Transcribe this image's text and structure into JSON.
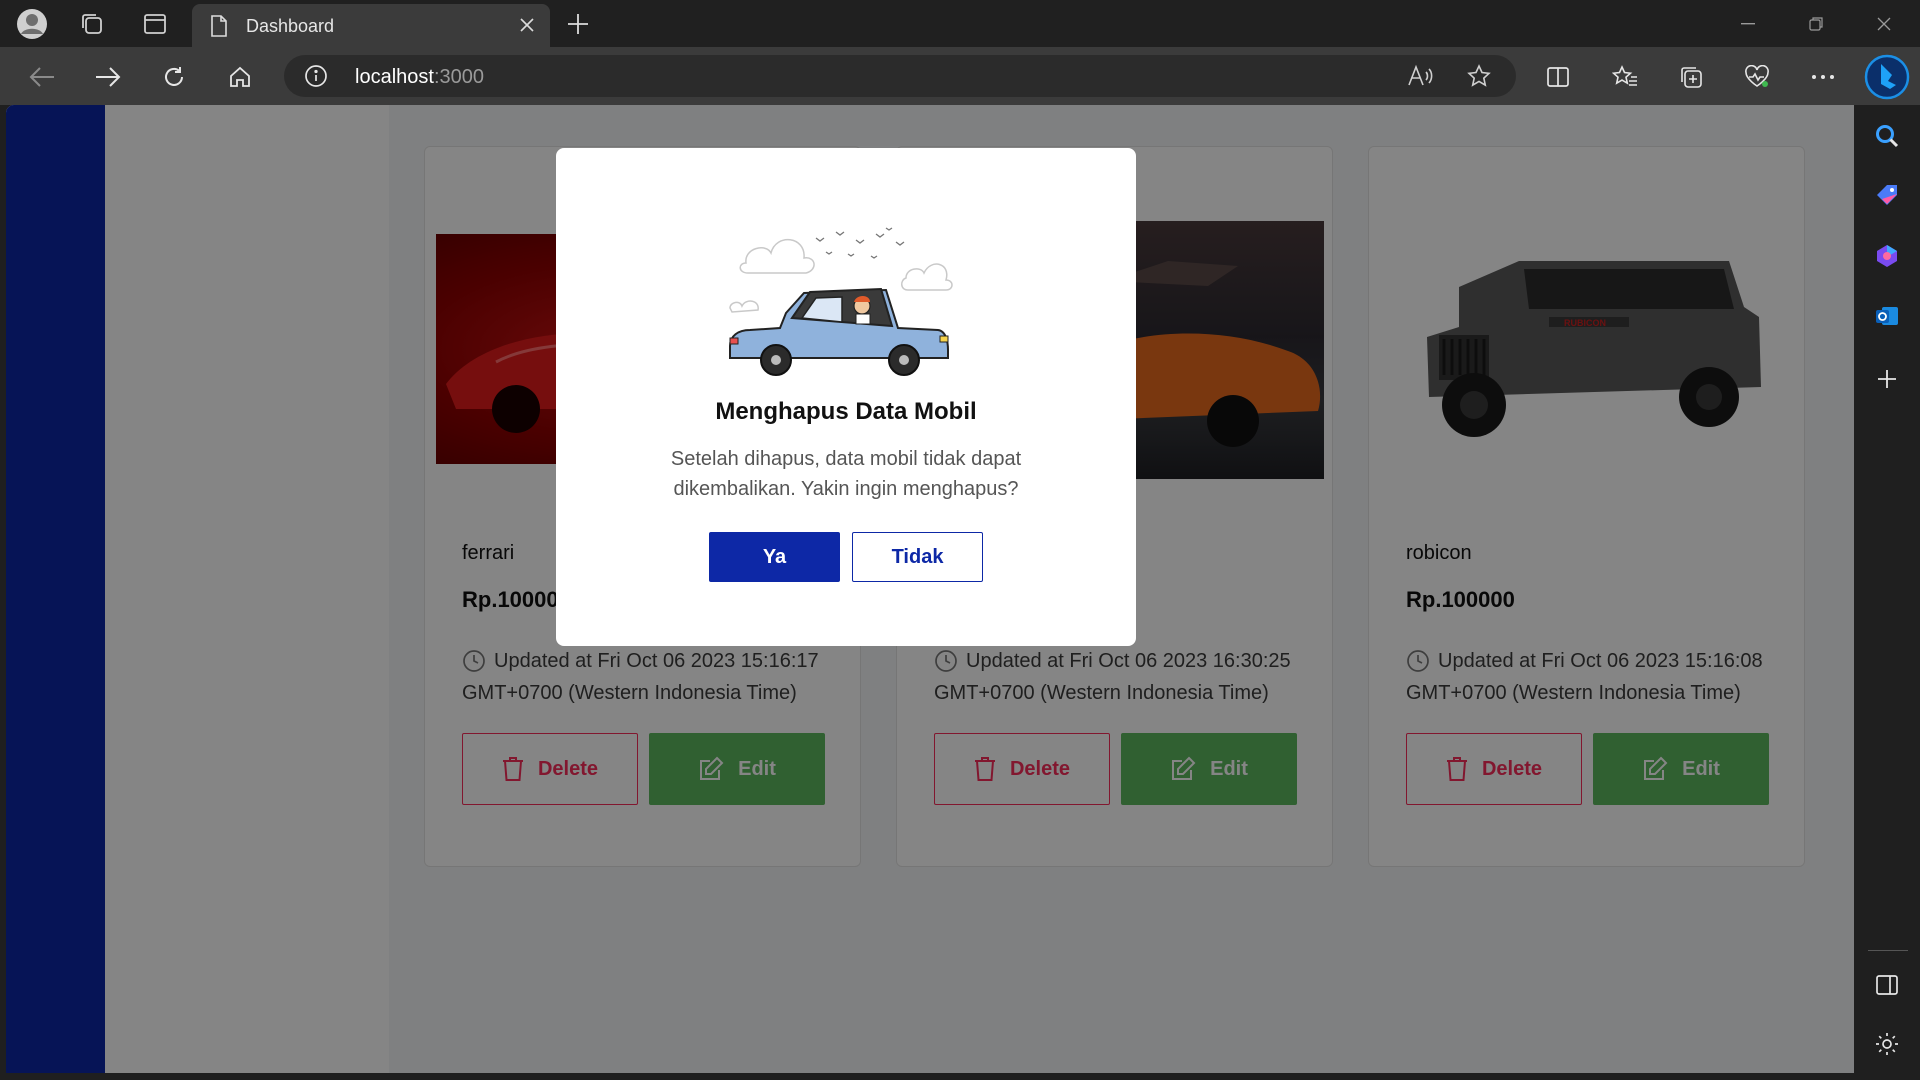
{
  "browser": {
    "tab_title": "Dashboard",
    "url_host": "localhost",
    "url_port": ":3000"
  },
  "cars": [
    {
      "name": "ferrari",
      "price": "Rp.100000",
      "updated": "Updated at Fri Oct 06 2023 15:16:17 GMT+0700 (Western Indonesia Time)",
      "delete_label": "Delete",
      "edit_label": "Edit"
    },
    {
      "name": "",
      "price": "",
      "updated": "Updated at Fri Oct 06 2023 16:30:25 GMT+0700 (Western Indonesia Time)",
      "delete_label": "Delete",
      "edit_label": "Edit"
    },
    {
      "name": "robicon",
      "price": "Rp.100000",
      "updated": "Updated at Fri Oct 06 2023 15:16:08 GMT+0700 (Western Indonesia Time)",
      "delete_label": "Delete",
      "edit_label": "Edit"
    }
  ],
  "modal": {
    "title": "Menghapus Data Mobil",
    "message": "Setelah dihapus, data mobil tidak dapat dikembalikan. Yakin ingin menghapus?",
    "confirm_label": "Ya",
    "cancel_label": "Tidak"
  },
  "colors": {
    "primary": "#0d28a6",
    "danger": "#fa2c5a",
    "success": "#5cb85f"
  }
}
